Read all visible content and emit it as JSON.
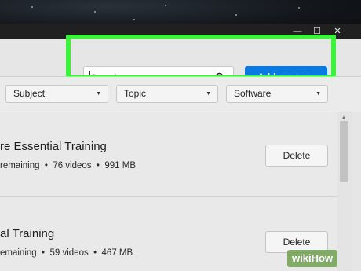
{
  "window": {
    "controls": {
      "minimize": "—",
      "maximize": "☐",
      "close": "✕"
    }
  },
  "search": {
    "placeholder": "Search",
    "value": ""
  },
  "toolbar": {
    "add_label": "Add courses",
    "accent": "#0a7ae0"
  },
  "highlight_color": "#3df23d",
  "filters": [
    {
      "label": "Subject"
    },
    {
      "label": "Topic"
    },
    {
      "label": "Software"
    }
  ],
  "courses": [
    {
      "title": "re Essential Training",
      "remaining": "remaining",
      "videos": "76 videos",
      "size": "991 MB",
      "action": "Delete"
    },
    {
      "title": "al Training",
      "remaining": "emaining",
      "videos": "59 videos",
      "size": "467 MB",
      "action": "Delete"
    }
  ],
  "watermark": "wikiHow"
}
